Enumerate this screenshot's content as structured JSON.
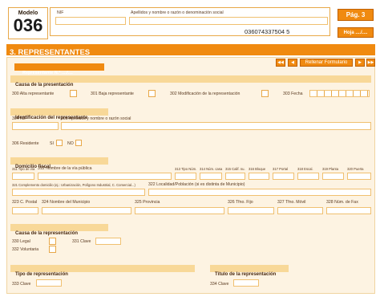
{
  "header": {
    "modelo_label": "Modelo",
    "modelo_number": "036",
    "nif_label": "NIF",
    "name_label": "Apellidos y nombre o razón o denominación social",
    "barcode_number": "036074337504 5",
    "page_badge": "Pág. 3",
    "page_sub": "Hoja ..../...."
  },
  "section": {
    "title": "3. REPRESENTANTES"
  },
  "rep_tab": {
    "label": "Representante N.° ..../...."
  },
  "nav": {
    "first": "◀◀",
    "prev": "◀",
    "fill": "Rellenar Formulario",
    "next": "▶",
    "last": "▶▶"
  },
  "causa_presentacion": {
    "title": "Causa de la presentación",
    "f300": "300 Alta representante",
    "f301": "301 Baja representante",
    "f302": "302 Modificación de la representación",
    "f303": "303 Fecha"
  },
  "identificacion": {
    "title": "Identificación del representante",
    "f304": "304 NIF",
    "f305": "305 Apellidos y nombre o razón social",
    "f306": "306 Residente",
    "si": "SI",
    "no": "NO"
  },
  "domicilio": {
    "title": "Domicilio fiscal",
    "f311": "311 Tipo de vía",
    "f312": "312 Nombre de la vía pública",
    "f313": "313 Tipo Núm.",
    "f314": "314 Núm. casa",
    "f315": "315 Calif. nu.",
    "f316": "316 Bloque",
    "f317": "317 Portal",
    "f318": "318 Escal.",
    "f319": "319 Planta",
    "f320": "320 Puerta",
    "f321": "321 Complemento domicilio (ej.: Urbanización, Polígono Industrial, C. Comercial...)",
    "f322": "322 Localidad/Población (si es distinta de Municipio)",
    "f323": "323 C. Postal",
    "f324": "324 Nombre del Municipio",
    "f325": "325 Provincia",
    "f326": "326 Tfno. Fijo",
    "f327": "327 Tfno. Móvil",
    "f328": "328 Núm. de Fax"
  },
  "causa_representacion": {
    "title": "Causa de la representación",
    "f330": "330 Legal",
    "f331": "331 Clave",
    "f332": "332 Voluntaria"
  },
  "tipo": {
    "title": "Tipo de representación",
    "f333": "333 Clave"
  },
  "titulo": {
    "title": "Título de la representación",
    "f334": "334 Clave"
  }
}
